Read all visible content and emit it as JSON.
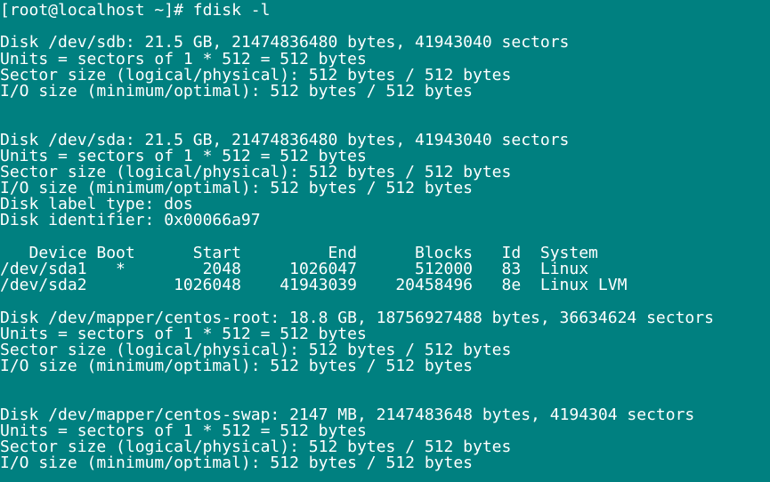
{
  "terminal": {
    "background": "#008080",
    "foreground": "#ffffff",
    "lines": [
      "[root@localhost ~]# fdisk -l",
      "",
      "Disk /dev/sdb: 21.5 GB, 21474836480 bytes, 41943040 sectors",
      "Units = sectors of 1 * 512 = 512 bytes",
      "Sector size (logical/physical): 512 bytes / 512 bytes",
      "I/O size (minimum/optimal): 512 bytes / 512 bytes",
      "",
      "",
      "Disk /dev/sda: 21.5 GB, 21474836480 bytes, 41943040 sectors",
      "Units = sectors of 1 * 512 = 512 bytes",
      "Sector size (logical/physical): 512 bytes / 512 bytes",
      "I/O size (minimum/optimal): 512 bytes / 512 bytes",
      "Disk label type: dos",
      "Disk identifier: 0x00066a97",
      "",
      "   Device Boot      Start         End      Blocks   Id  System",
      "/dev/sda1   *        2048     1026047      512000   83  Linux",
      "/dev/sda2         1026048    41943039    20458496   8e  Linux LVM",
      "",
      "Disk /dev/mapper/centos-root: 18.8 GB, 18756927488 bytes, 36634624 sectors",
      "Units = sectors of 1 * 512 = 512 bytes",
      "Sector size (logical/physical): 512 bytes / 512 bytes",
      "I/O size (minimum/optimal): 512 bytes / 512 bytes",
      "",
      "",
      "Disk /dev/mapper/centos-swap: 2147 MB, 2147483648 bytes, 4194304 sectors",
      "Units = sectors of 1 * 512 = 512 bytes",
      "Sector size (logical/physical): 512 bytes / 512 bytes",
      "I/O size (minimum/optimal): 512 bytes / 512 bytes"
    ]
  }
}
